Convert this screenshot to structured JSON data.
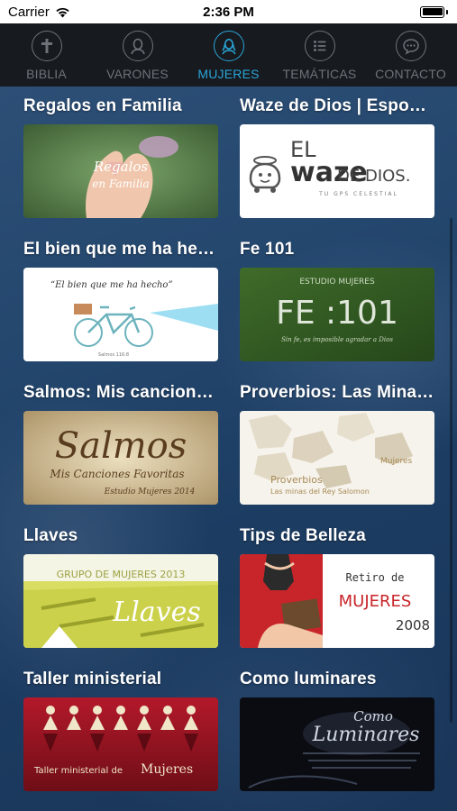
{
  "status_bar": {
    "carrier": "Carrier",
    "time": "2:36 PM"
  },
  "tabs": [
    {
      "label": "BIBLIA",
      "icon": "cross-icon",
      "active": false
    },
    {
      "label": "VARONES",
      "icon": "man-icon",
      "active": false
    },
    {
      "label": "MUJERES",
      "icon": "woman-icon",
      "active": true
    },
    {
      "label": "TEMÁTICAS",
      "icon": "list-icon",
      "active": false
    },
    {
      "label": "CONTACTO",
      "icon": "chat-bubble-icon",
      "active": false
    }
  ],
  "items": [
    {
      "title": "Regalos en Familia",
      "thumb": {
        "line1": "Regalos",
        "line2": "en Familia"
      }
    },
    {
      "title": "Waze de Dios | Esposos",
      "thumb": {
        "line1": "EL",
        "brand": "waze",
        "line2": "DE DIOS.",
        "tagline": "TU GPS CELESTIAL"
      }
    },
    {
      "title": "El bien que me ha hecho",
      "thumb": {
        "quote": "“El bien que me ha hecho”",
        "ref": "Salmos 116:8"
      }
    },
    {
      "title": "Fe 101",
      "thumb": {
        "label": "ESTUDIO MUJERES",
        "big": "FE :101",
        "caption": "Sin fe, es imposible agradar a Dios"
      }
    },
    {
      "title": "Salmos: Mis canciones favoritas",
      "thumb": {
        "big": "Salmos",
        "sub": "Mis Canciones Favoritas",
        "small": "Estudio Mujeres 2014"
      }
    },
    {
      "title": "Proverbios: Las Minas del Rey Salomón",
      "thumb": {
        "label": "Mujeres",
        "line1": "Proverbios",
        "line2": "Las minas del Rey Salomon"
      }
    },
    {
      "title": "Llaves",
      "thumb": {
        "label": "GRUPO DE MUJERES 2013",
        "big": "Llaves"
      }
    },
    {
      "title": "Tips de Belleza",
      "thumb": {
        "line1": "Retiro de",
        "big": "MUJERES",
        "year": "2008"
      }
    },
    {
      "title": "Taller ministerial",
      "thumb": {
        "line1": "Taller ministerial de",
        "big": "Mujeres"
      }
    },
    {
      "title": "Como luminares",
      "thumb": {
        "line1": "Como",
        "big": "Luminares"
      }
    }
  ],
  "colors": {
    "accent": "#2aa6d8",
    "tab_bar": "#171a1f",
    "inactive": "#6e737a"
  }
}
